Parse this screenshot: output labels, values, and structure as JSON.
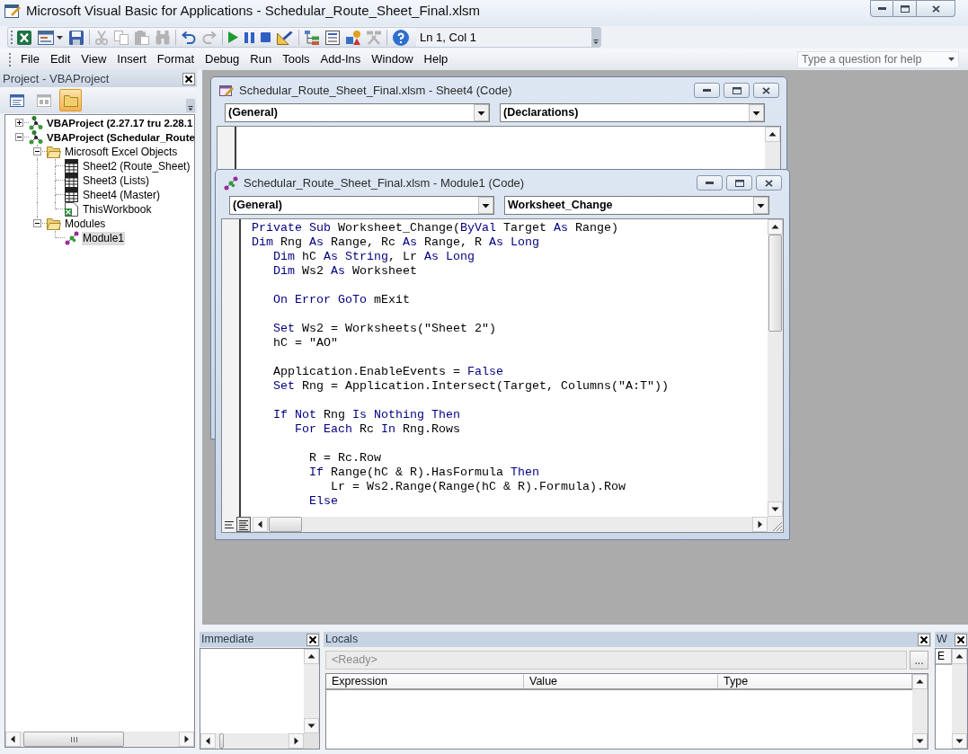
{
  "window": {
    "title": "Microsoft Visual Basic for Applications - Schedular_Route_Sheet_Final.xlsm"
  },
  "toolbar": {
    "groups": [
      [
        {
          "kind": "excel",
          "disabled": false
        },
        {
          "kind": "userform",
          "disabled": false
        },
        {
          "kind": "save",
          "disabled": false
        }
      ],
      [
        {
          "kind": "cut",
          "disabled": true
        },
        {
          "kind": "copy",
          "disabled": true
        },
        {
          "kind": "paste",
          "disabled": true
        },
        {
          "kind": "find",
          "disabled": true
        }
      ],
      [
        {
          "kind": "undo",
          "disabled": false
        },
        {
          "kind": "redo",
          "disabled": true
        }
      ],
      [
        {
          "kind": "run",
          "disabled": false
        },
        {
          "kind": "break",
          "disabled": false
        },
        {
          "kind": "reset",
          "disabled": false
        },
        {
          "kind": "design",
          "disabled": false
        }
      ],
      [
        {
          "kind": "project",
          "disabled": false
        },
        {
          "kind": "properties",
          "disabled": false
        },
        {
          "kind": "browser",
          "disabled": false
        },
        {
          "kind": "toolbox",
          "disabled": true
        }
      ],
      [
        {
          "kind": "help",
          "disabled": false
        }
      ]
    ],
    "position": "Ln 1, Col 1"
  },
  "menu": [
    "File",
    "Edit",
    "View",
    "Insert",
    "Format",
    "Debug",
    "Run",
    "Tools",
    "Add-Ins",
    "Window",
    "Help"
  ],
  "help_box": {
    "placeholder": "Type a question for help"
  },
  "project": {
    "title": "Project - VBAProject",
    "views": [
      {
        "kind": "code",
        "disabled": false,
        "selected": false
      },
      {
        "kind": "object",
        "disabled": true,
        "selected": false
      },
      {
        "kind": "folders",
        "disabled": false,
        "selected": true
      }
    ],
    "tree": [
      {
        "label": "VBAProject (2.27.17 tru 2.28.1",
        "kind": "project",
        "expanded": false,
        "selected": false
      },
      {
        "label": "VBAProject (Schedular_Route",
        "kind": "project",
        "expanded": true,
        "selected": false,
        "children": [
          {
            "label": "Microsoft Excel Objects",
            "kind": "folder",
            "expanded": true,
            "selected": false,
            "children": [
              {
                "label": "Sheet2 (Route_Sheet)",
                "kind": "sheet",
                "selected": false
              },
              {
                "label": "Sheet3 (Lists)",
                "kind": "sheet",
                "selected": false
              },
              {
                "label": "Sheet4 (Master)",
                "kind": "sheet",
                "selected": false
              },
              {
                "label": "ThisWorkbook",
                "kind": "workbook",
                "selected": false
              }
            ]
          },
          {
            "label": "Modules",
            "kind": "folder",
            "expanded": true,
            "selected": false,
            "children": [
              {
                "label": "Module1",
                "kind": "module",
                "selected": true
              }
            ]
          }
        ]
      }
    ]
  },
  "code_windows": [
    {
      "kind": "sheet",
      "title": "Schedular_Route_Sheet_Final.xlsm - Sheet4 (Code)",
      "object": "(General)",
      "procedure": "(Declarations)"
    },
    {
      "kind": "module",
      "title": "Schedular_Route_Sheet_Final.xlsm - Module1 (Code)",
      "object": "(General)",
      "procedure": "Worksheet_Change",
      "views": [
        {
          "kind": "procedure",
          "selected": false
        },
        {
          "kind": "module",
          "selected": true
        }
      ],
      "blocks": [
        [
          [
            {
              "kind": "keyword",
              "text": "Private Sub"
            },
            {
              "kind": "plain",
              "text": " Worksheet_Change("
            },
            {
              "kind": "keyword",
              "text": "ByVal"
            },
            {
              "kind": "plain",
              "text": " Target "
            },
            {
              "kind": "keyword",
              "text": "As"
            },
            {
              "kind": "plain",
              "text": " Range)"
            }
          ],
          [
            {
              "kind": "keyword",
              "text": "Dim"
            },
            {
              "kind": "plain",
              "text": " Rng "
            },
            {
              "kind": "keyword",
              "text": "As"
            },
            {
              "kind": "plain",
              "text": " Range, Rc "
            },
            {
              "kind": "keyword",
              "text": "As"
            },
            {
              "kind": "plain",
              "text": " Range, R "
            },
            {
              "kind": "keyword",
              "text": "As Long"
            }
          ],
          [
            {
              "kind": "keyword",
              "text": "   Dim"
            },
            {
              "kind": "plain",
              "text": " hC "
            },
            {
              "kind": "keyword",
              "text": "As String"
            },
            {
              "kind": "plain",
              "text": ", Lr "
            },
            {
              "kind": "keyword",
              "text": "As Long"
            }
          ],
          [
            {
              "kind": "keyword",
              "text": "   Dim"
            },
            {
              "kind": "plain",
              "text": " Ws2 "
            },
            {
              "kind": "keyword",
              "text": "As"
            },
            {
              "kind": "plain",
              "text": " Worksheet"
            }
          ]
        ],
        [
          [
            {
              "kind": "keyword",
              "text": "   On Error GoTo"
            },
            {
              "kind": "plain",
              "text": " mExit"
            }
          ]
        ],
        [
          [
            {
              "kind": "keyword",
              "text": "   Set"
            },
            {
              "kind": "plain",
              "text": " Ws2 = Worksheets(\"Sheet 2\")"
            }
          ],
          [
            {
              "kind": "plain",
              "text": "   hC = \"AO\""
            }
          ]
        ],
        [
          [
            {
              "kind": "plain",
              "text": "   Application.EnableEvents = "
            },
            {
              "kind": "keyword",
              "text": "False"
            }
          ],
          [
            {
              "kind": "keyword",
              "text": "   Set"
            },
            {
              "kind": "plain",
              "text": " Rng = Application.Intersect(Target, Columns(\"A:T\"))"
            }
          ]
        ],
        [
          [
            {
              "kind": "keyword",
              "text": "   If Not"
            },
            {
              "kind": "plain",
              "text": " Rng "
            },
            {
              "kind": "keyword",
              "text": "Is Nothing Then"
            }
          ],
          [
            {
              "kind": "keyword",
              "text": "      For Each"
            },
            {
              "kind": "plain",
              "text": " Rc "
            },
            {
              "kind": "keyword",
              "text": "In"
            },
            {
              "kind": "plain",
              "text": " Rng.Rows"
            }
          ]
        ],
        [
          [
            {
              "kind": "plain",
              "text": "        R = Rc.Row"
            }
          ],
          [
            {
              "kind": "keyword",
              "text": "        If"
            },
            {
              "kind": "plain",
              "text": " Range(hC & R).HasFormula "
            },
            {
              "kind": "keyword",
              "text": "Then"
            }
          ],
          [
            {
              "kind": "plain",
              "text": "           Lr = Ws2.Range(Range(hC & R).Formula).Row"
            }
          ],
          [
            {
              "kind": "keyword",
              "text": "        Else"
            }
          ]
        ]
      ]
    }
  ],
  "immediate": {
    "title": "Immediate"
  },
  "locals": {
    "title": "Locals",
    "status": "<Ready>",
    "button": "...",
    "columns": [
      "Expression",
      "Value",
      "Type"
    ]
  },
  "watches": {
    "title": "W",
    "columns": [
      "E"
    ]
  }
}
